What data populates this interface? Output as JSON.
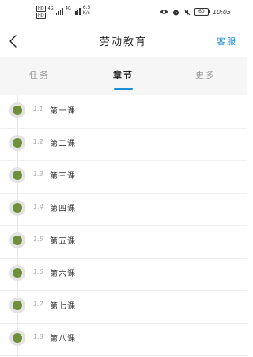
{
  "status_bar": {
    "hd_top": "HD",
    "hd_bottom": "HD",
    "net1": "4G",
    "net2": "4G",
    "speed_value": "6.5",
    "speed_unit": "K/s",
    "battery": "60",
    "time": "10:05",
    "icons": [
      "eye-icon",
      "alarm-icon",
      "mute-icon",
      "battery-icon"
    ]
  },
  "nav": {
    "back_icon": "chevron-left-icon",
    "title": "劳动教育",
    "service_label": "客服"
  },
  "tabs": [
    {
      "label": "任务",
      "active": false
    },
    {
      "label": "章节",
      "active": true
    },
    {
      "label": "更多",
      "active": false
    }
  ],
  "colors": {
    "accent": "#1e8fd6",
    "dot_fill": "#6f8f3a",
    "dot_ring": "#e3e3e3"
  },
  "chapters": [
    {
      "num": "1.1",
      "title": "第一课"
    },
    {
      "num": "1.2",
      "title": "第二课"
    },
    {
      "num": "1.3",
      "title": "第三课"
    },
    {
      "num": "1.4",
      "title": "第四课"
    },
    {
      "num": "1.5",
      "title": "第五课"
    },
    {
      "num": "1.6",
      "title": "第六课"
    },
    {
      "num": "1.7",
      "title": "第七课"
    },
    {
      "num": "1.8",
      "title": "第八课"
    }
  ]
}
